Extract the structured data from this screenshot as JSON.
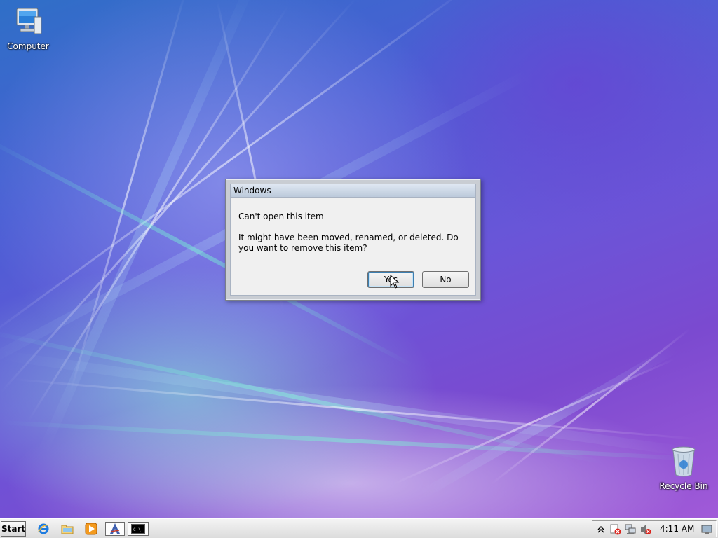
{
  "desktop": {
    "icons": [
      {
        "label": "Computer",
        "icon": "computer-icon"
      },
      {
        "label": "Recycle Bin",
        "icon": "recycle-bin-icon"
      }
    ]
  },
  "dialog": {
    "title": "Windows",
    "main_instruction": "Can't open this item",
    "content": "It might have been moved, renamed, or deleted. Do you want to remove this item?",
    "buttons": {
      "yes": "Yes",
      "no": "No"
    },
    "default_button": "yes"
  },
  "taskbar": {
    "start_label": "Start",
    "quick_launch": [
      "internet-explorer-icon",
      "folder-icon",
      "media-player-icon",
      "app-icon",
      "command-prompt-icon"
    ],
    "command_prompt_glyph": "C:\\_",
    "tray": {
      "icons": [
        "show-hidden-icons-chevron",
        "security-alert-icon",
        "network-icon",
        "volume-muted-icon",
        "action-center-icon"
      ],
      "clock": "4:11 AM"
    }
  },
  "colors": {
    "accent_blue": "#3c7fb1",
    "titlebar": "#bccadb",
    "dialog_bg": "#f0f0f0"
  }
}
